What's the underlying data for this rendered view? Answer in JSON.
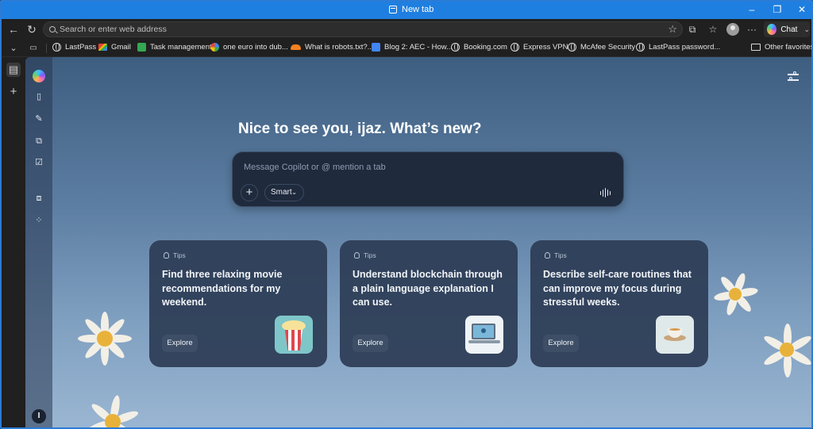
{
  "window": {
    "title": "New tab"
  },
  "address_bar": {
    "placeholder": "Search or enter web address"
  },
  "toolbar": {
    "chat_label": "Chat"
  },
  "favorites": {
    "items": [
      {
        "label": "LastPass",
        "icon": "globe-icon"
      },
      {
        "label": "Gmail",
        "icon": "gmail-icon"
      },
      {
        "label": "Task management",
        "icon": "sheets-icon"
      },
      {
        "label": "one euro into dub...",
        "icon": "google-icon"
      },
      {
        "label": "What is robots.txt?...",
        "icon": "cloudflare-icon"
      },
      {
        "label": "Blog 2: AEC - How...",
        "icon": "docs-icon"
      },
      {
        "label": "Booking.com",
        "icon": "globe-icon"
      },
      {
        "label": "Express VPN",
        "icon": "globe-icon"
      },
      {
        "label": "McAfee Security",
        "icon": "globe-icon"
      },
      {
        "label": "LastPass password...",
        "icon": "globe-icon"
      }
    ],
    "other_label": "Other favorites"
  },
  "copilot": {
    "greeting": "Nice to see you, ijaz. What’s new?",
    "input_placeholder": "Message Copilot or @ mention a tab",
    "mode_label": "Smart",
    "user_initial": "I"
  },
  "cards": [
    {
      "tag": "Tips",
      "text": "Find three relaxing movie recommendations for my weekend.",
      "button": "Explore",
      "thumb": "popcorn-icon"
    },
    {
      "tag": "Tips",
      "text": "Understand blockchain through a plain language explanation I can use.",
      "button": "Explore",
      "thumb": "laptop-network-icon"
    },
    {
      "tag": "Tips",
      "text": "Describe self-care routines that can improve my focus during stressful weeks.",
      "button": "Explore",
      "thumb": "tea-cup-icon"
    }
  ],
  "colors": {
    "titlebar": "#1f7fe0",
    "chrome": "#202020",
    "card": "#2c3c55",
    "composer": "#1f2a3d"
  }
}
